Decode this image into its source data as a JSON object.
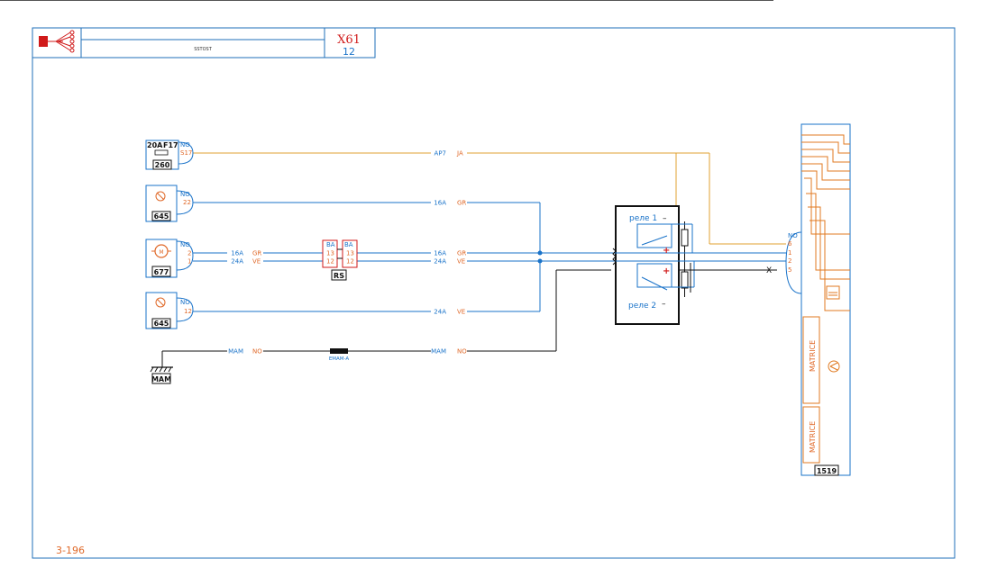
{
  "header": {
    "subtitle": "SSTOST",
    "code": "X61",
    "page": "12"
  },
  "footer": {
    "ref": "3-196"
  },
  "colors": {
    "frame": "#1f6fb8",
    "wire_blue": "#1a73c9",
    "wire_orange": "#e07a20",
    "wire_yellow": "#e0a030",
    "label_orange": "#e06a2a",
    "black": "#111111",
    "red": "#d01a1a"
  },
  "components": {
    "fuse": {
      "rating": "20A",
      "ref": "F17",
      "id": "260",
      "pin_label": "NO",
      "pin": "S17"
    },
    "sensor_top": {
      "id": "645",
      "pin_label": "NO",
      "pin": "22",
      "icon": "thermal-sensor-icon"
    },
    "motor": {
      "id": "677",
      "pin_label": "NO",
      "pins": [
        "2",
        "1"
      ],
      "icon": "motor-icon"
    },
    "sensor_bottom": {
      "id": "645",
      "pin_label": "NO",
      "pin": "12",
      "icon": "thermal-sensor-icon"
    },
    "ground": {
      "id": "MAM",
      "icon": "ground-icon"
    },
    "connector_rs": {
      "id": "RS",
      "label_left": "BA",
      "label_right": "BA",
      "pins_left": [
        "13",
        "12"
      ],
      "pins_right": [
        "13",
        "12"
      ]
    },
    "splice": {
      "label": "EMAM-A"
    },
    "relay_box": {
      "relay1": "реле 1",
      "relay2": "реле 2"
    },
    "ecu": {
      "id": "1519",
      "pin_label": "NO",
      "pins": [
        "6",
        "1",
        "2",
        "5"
      ],
      "block1": "MATRICE",
      "block2": "MATRICE",
      "icon": "sensor-icon"
    }
  },
  "wires": {
    "w_ap7": {
      "code": "AP7",
      "color": "JA"
    },
    "w_16a_top": {
      "code": "16A",
      "color": "GR"
    },
    "w_16a_mid_l": {
      "code": "16A",
      "color": "GR"
    },
    "w_24a_mid_l": {
      "code": "24A",
      "color": "VE"
    },
    "w_16a_mid_r": {
      "code": "16A",
      "color": "GR"
    },
    "w_24a_mid_r": {
      "code": "24A",
      "color": "VE"
    },
    "w_24a_bot": {
      "code": "24A",
      "color": "VE"
    },
    "w_mam_l": {
      "code": "MAM",
      "color": "NO"
    },
    "w_mam_r": {
      "code": "MAM",
      "color": "NO"
    }
  },
  "marks": {
    "x_mark": "X",
    "plus": "+",
    "minus": "–"
  }
}
